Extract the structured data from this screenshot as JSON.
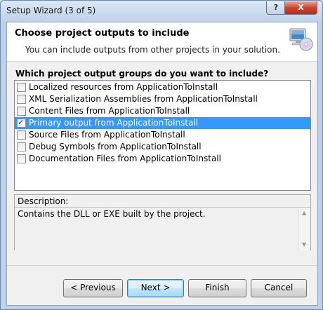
{
  "window": {
    "title": "Setup Wizard (3 of 5)",
    "help_label": "?",
    "close_label": "X"
  },
  "header": {
    "title": "Choose project outputs to include",
    "subtitle": "You can include outputs from other projects in your solution.",
    "icon": "computer-cd-icon"
  },
  "groups": {
    "label": "Which project output groups do you want to include?",
    "items": [
      {
        "label": "Localized resources from ApplicationToInstall",
        "checked": false,
        "selected": false
      },
      {
        "label": "XML Serialization Assemblies from ApplicationToInstall",
        "checked": false,
        "selected": false
      },
      {
        "label": "Content Files from ApplicationToInstall",
        "checked": false,
        "selected": false
      },
      {
        "label": "Primary output from ApplicationToInstall",
        "checked": true,
        "selected": true
      },
      {
        "label": "Source Files from ApplicationToInstall",
        "checked": false,
        "selected": false
      },
      {
        "label": "Debug Symbols from ApplicationToInstall",
        "checked": false,
        "selected": false
      },
      {
        "label": "Documentation Files from ApplicationToInstall",
        "checked": false,
        "selected": false
      }
    ]
  },
  "description": {
    "label": "Description:",
    "text": "Contains the DLL or EXE built by the project."
  },
  "buttons": {
    "previous": "< Previous",
    "next": "Next >",
    "finish": "Finish",
    "cancel": "Cancel"
  },
  "colors": {
    "selection": "#3399ff",
    "default_button_border": "#3c7fb1"
  }
}
